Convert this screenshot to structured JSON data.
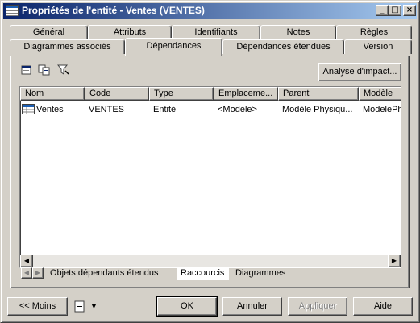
{
  "window": {
    "title": "Propriétés de l'entité - Ventes (VENTES)",
    "controls": {
      "minimize": "_",
      "maximize": "□",
      "close": "×"
    }
  },
  "tabs": {
    "row1": [
      "Général",
      "Attributs",
      "Identifiants",
      "Notes",
      "Règles"
    ],
    "row2": [
      "Diagrammes associés",
      "Dépendances",
      "Dépendances étendues",
      "Version"
    ],
    "active": "Dépendances"
  },
  "toolbar": {
    "icons": [
      "properties-icon",
      "copy-icon",
      "filter-icon"
    ],
    "impact_button": "Analyse d'impact..."
  },
  "table": {
    "columns": [
      "Nom",
      "Code",
      "Type",
      "Emplaceme...",
      "Parent",
      "Modèle"
    ],
    "rows": [
      {
        "nom": "Ventes",
        "code": "VENTES",
        "type": "Entité",
        "emplacement": "<Modèle>",
        "parent": "Modèle Physiqu...",
        "modele": "ModelePh"
      }
    ]
  },
  "subtabs": [
    "Objets dépendants étendus",
    "Raccourcis",
    "Diagrammes"
  ],
  "active_subtab": "Raccourcis",
  "footer": {
    "less": "<< Moins",
    "ok": "OK",
    "cancel": "Annuler",
    "apply": "Appliquer",
    "help": "Aide"
  }
}
